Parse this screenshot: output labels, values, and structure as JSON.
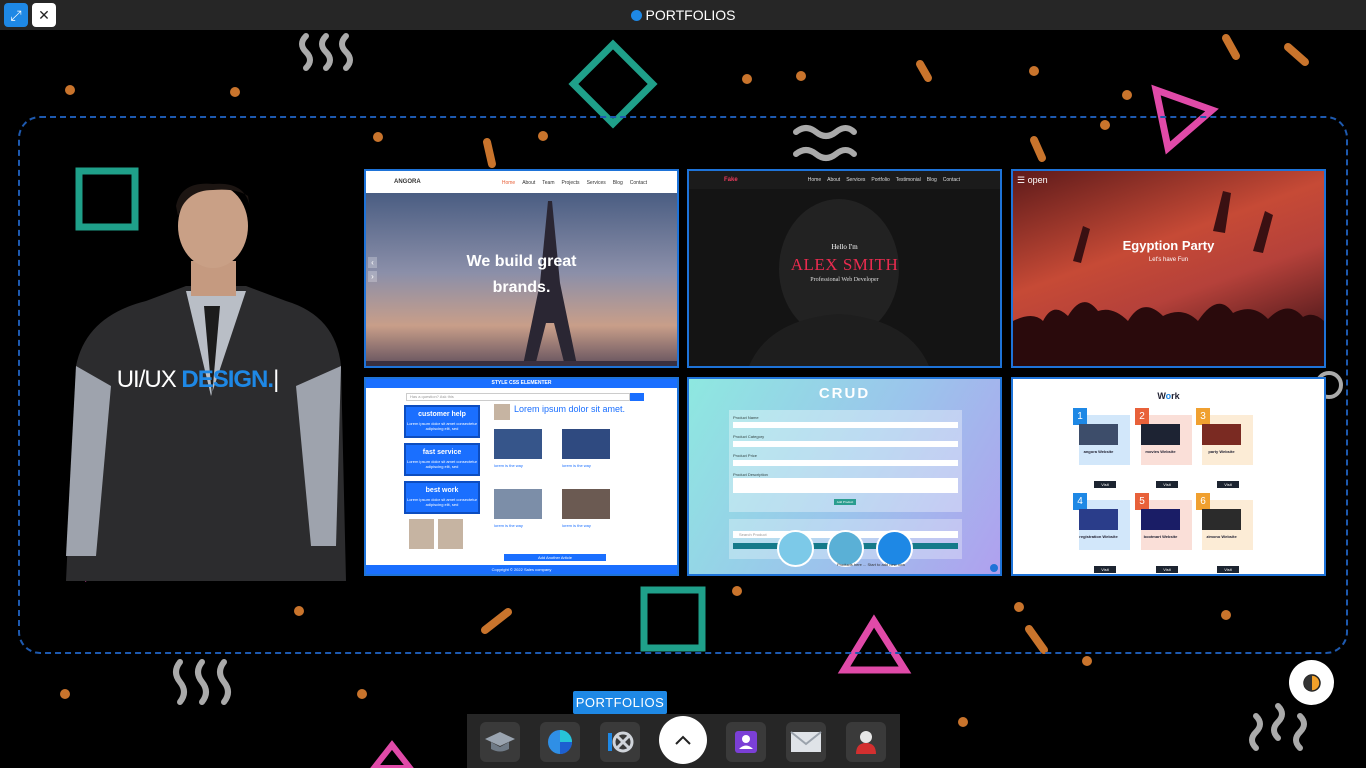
{
  "window": {
    "title": "PORTFOLIOS",
    "expand_icon": "expand-icon",
    "close_icon": "close-icon",
    "expand_glyph": "⤢",
    "close_glyph": "✕"
  },
  "hero": {
    "text_plain": "UI/UX ",
    "text_accent": "DESIGN.",
    "cursor": "|"
  },
  "portfolio": {
    "angora": {
      "logo": "ANGORA",
      "nav": [
        "Home",
        "About",
        "Team",
        "Projects",
        "Services",
        "Blog",
        "Contact"
      ],
      "headline_1": "We build great",
      "headline_2": "brands."
    },
    "alex": {
      "brand": "Fake",
      "nav": [
        "Home",
        "About",
        "Services",
        "Portfolio",
        "Testimonial",
        "Blog",
        "Contact"
      ],
      "greeting": "Hello I'm",
      "name": "ALEX SMITH",
      "role": "Professional Web Developer"
    },
    "party": {
      "menu": "☰ open",
      "title": "Egyption Party",
      "subtitle": "Let's have Fun"
    },
    "elementer": {
      "title": "STYLE CSS ELEMENTER",
      "question_placeholder": "Has a question? Ask this",
      "boxes": [
        {
          "title": "customer help",
          "text": "Lorem ipsum dolor sit amet consectetur adipiscing elit, sed"
        },
        {
          "title": "fast service",
          "text": "Lorem ipsum dolor sit amet consectetur adipiscing elit, sed"
        },
        {
          "title": "best work",
          "text": "Lorem ipsum dolor sit amet consectetur adipiscing elit, sed"
        }
      ],
      "heading": "Lorem ipsum dolor sit amet.",
      "captions": [
        "lorem is the way",
        "lorem is the way",
        "lorem is the way",
        "lorem is the way"
      ],
      "add_button": "Add Another Article",
      "footer": "Copyright © 2022 Sales company"
    },
    "crud": {
      "title": "CRUD",
      "labels": [
        "Product Name",
        "Product Category",
        "Product Price",
        "Product Description"
      ],
      "add_button": "Add Product",
      "search_placeholder": "Search Product",
      "products_text": "Products here ... Start to add new now"
    },
    "work": {
      "title_a": "W",
      "title_b": "o",
      "title_c": "rk",
      "items": [
        {
          "num": "1",
          "label": "angora Website",
          "visit": "Visit",
          "tag": "#1e88e5",
          "img": "#3d4d6a"
        },
        {
          "num": "2",
          "label": "movies Website",
          "visit": "Visit",
          "tag": "#e8613a",
          "img": "#1d2333"
        },
        {
          "num": "3",
          "label": "party Website",
          "visit": "Visit",
          "tag": "#f0a030",
          "img": "#7a2a22"
        },
        {
          "num": "4",
          "label": "registration Website",
          "visit": "Visit",
          "tag": "#1e88e5",
          "img": "#2a3d8a"
        },
        {
          "num": "5",
          "label": "bootmart Website",
          "visit": "Visit",
          "tag": "#e8613a",
          "img": "#1a1d66"
        },
        {
          "num": "6",
          "label": "zimono Website",
          "visit": "Visit",
          "tag": "#f0a030",
          "img": "#2b2b2b"
        }
      ]
    }
  },
  "dock": {
    "tooltip": "PORTFOLIOS",
    "items": [
      {
        "name": "education",
        "icon": "graduation-cap-icon"
      },
      {
        "name": "skills",
        "icon": "pie-chart-icon"
      },
      {
        "name": "portfolios",
        "icon": "portfolio-icon"
      },
      {
        "name": "home",
        "icon": "chevron-up-icon"
      },
      {
        "name": "about",
        "icon": "profile-card-icon"
      },
      {
        "name": "contact",
        "icon": "mail-icon"
      },
      {
        "name": "profile",
        "icon": "user-icon"
      }
    ]
  },
  "colors": {
    "accent": "#1e88e5",
    "decor_orange": "#c9742c",
    "decor_pink": "#e04aa8",
    "decor_teal": "#1fa08a"
  }
}
